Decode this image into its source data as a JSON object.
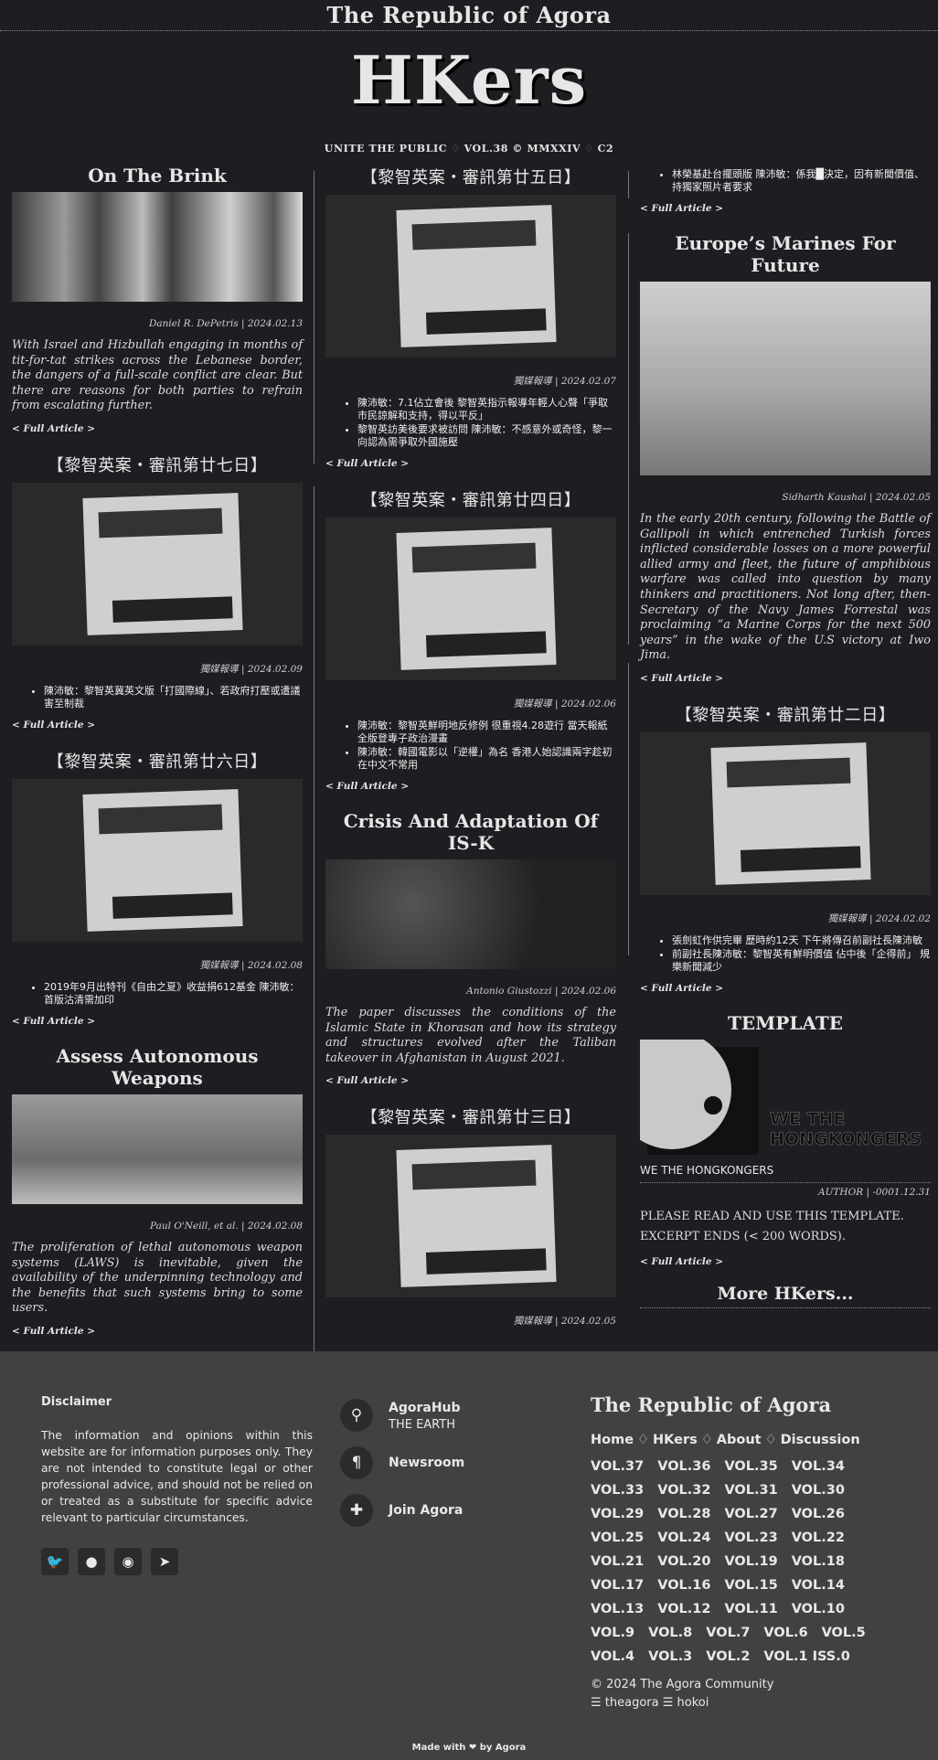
{
  "site": {
    "name": "The Republic of Agora",
    "logo": "HKers",
    "strap_left": "UNITE THE PUBLIC",
    "strap_mid": "VOL.38 © MMXXIV",
    "strap_right": "C2",
    "diamond": "♢",
    "more": "More HKers..."
  },
  "col1": [
    {
      "title": "On The Brink",
      "byline": "Daniel R. DePetris | 2024.02.13",
      "abstract": "With Israel and Hizbullah engaging in months of tit-for-tat strikes across the Lebanese border, the dangers of a full-scale conflict are clear. But there are reasons for both parties to refrain from escalating further.",
      "full": "< Full Article >"
    },
    {
      "title": "【黎智英案・審訊第廿七日】",
      "byline": "獨媒報導 | 2024.02.09",
      "bullets": [
        "陳沛敏：黎智英冀英文版「打國際線」、若政府打壓或遭議害至制裁"
      ],
      "full": "< Full Article >"
    },
    {
      "title": "【黎智英案・審訊第廿六日】",
      "byline": "獨媒報導 | 2024.02.08",
      "bullets": [
        "2019年9月出特刊《自由之夏》收益捐612基金 陳沛敏：首版沽清需加印"
      ],
      "full": "< Full Article >"
    },
    {
      "title": "Assess Autonomous Weapons",
      "byline": "Paul O'Neill, et al. | 2024.02.08",
      "abstract": "The proliferation of lethal autonomous weapon systems (LAWS) is inevitable, given the availability of the underpinning technology and the benefits that such systems bring to some users.",
      "full": "< Full Article >"
    }
  ],
  "col2": [
    {
      "title": "【黎智英案・審訊第廿五日】",
      "byline": "獨媒報導 | 2024.02.07",
      "bullets": [
        "陳沛敏：7.1佔立會後 黎智英指示報導年輕人心聲「爭取市民諒解和支持，得以平反」",
        "黎智英訪美後要求被訪問 陳沛敏：不感意外或奇怪，黎一向認為需爭取外國施壓"
      ],
      "full": "< Full Article >"
    },
    {
      "title": "【黎智英案・審訊第廿四日】",
      "byline": "獨媒報導 | 2024.02.06",
      "bullets": [
        "陳沛敏：黎智英鮮明地反修例 很重視4.28遊行 當天報紙全版登專子政治漫畫",
        "陳沛敏：韓國電影以「逆權」為名 香港人始認識兩字趁初在中文不常用"
      ],
      "full": "< Full Article >"
    },
    {
      "title": "Crisis And Adaptation Of IS-K",
      "byline": "Antonio Giustozzi | 2024.02.06",
      "abstract": "The paper discusses the conditions of the Islamic State in Khorasan and how its strategy and structures evolved after the Taliban takeover in Afghanistan in August 2021.",
      "full": "< Full Article >"
    },
    {
      "title": "【黎智英案・審訊第廿三日】",
      "byline": "獨媒報導 | 2024.02.05"
    }
  ],
  "col3": [
    {
      "bullets": [
        "林榮基赴台擺頭版 陳沛敏：係我█決定，因有新聞價值、持獨家照片者要求"
      ],
      "full": "< Full Article >"
    },
    {
      "title": "Europe’s Marines For Future",
      "byline": "Sidharth Kaushal | 2024.02.05",
      "abstract": "In the early 20th century, following the Battle of Gallipoli in which entrenched Turkish forces inflicted considerable losses on a more powerful allied army and fleet, the future of amphibious warfare was called into question by many thinkers and practitioners. Not long after, then-Secretary of the Navy James Forrestal was proclaiming “a Marine Corps for the next 500 years” in the wake of the U.S victory at Iwo Jima.",
      "full": "< Full Article >"
    },
    {
      "title": "【黎智英案・審訊第廿二日】",
      "byline": "獨媒報導 | 2024.02.02",
      "bullets": [
        "張劍虹作供完畢 歷時約12天 下午將傳召前副社長陳沛敏",
        "前副社長陳沛敏：黎智英有鮮明價值 佔中後「企得前」 規樂新聞減少"
      ],
      "full": "< Full Article >"
    },
    {
      "title": "TEMPLATE",
      "caption": "WE THE HONGKONGERS",
      "logo_text1": "WE THE",
      "logo_text2": "HONGKONGERS",
      "byline": "AUTHOR | -0001.12.31",
      "body": "PLEASE READ AND USE THIS TEMPLATE. EXCERPT ENDS (< 200 WORDS).",
      "full": "< Full Article >"
    }
  ],
  "footer": {
    "disc_title": "Disclaimer",
    "disc_text": "The information and opinions within this website are for information purposes only. They are not intended to constitute legal or other professional advice, and should not be relied on or treated as a substitute for specific advice relevant to particular circumstances.",
    "links": [
      {
        "label": "AgoraHub",
        "sub": "THE EARTH",
        "icon": "location-pin-icon"
      },
      {
        "label": "Newsroom",
        "icon": "pilcrow-icon"
      },
      {
        "label": "Join Agora",
        "icon": "puzzle-icon"
      }
    ],
    "brand": "The Republic of Agora",
    "nav": [
      "Home",
      "HKers",
      "About",
      "Discussion"
    ],
    "vols": [
      "VOL.37",
      "VOL.36",
      "VOL.35",
      "VOL.34",
      "VOL.33",
      "VOL.32",
      "VOL.31",
      "VOL.30",
      "VOL.29",
      "VOL.28",
      "VOL.27",
      "VOL.26",
      "VOL.25",
      "VOL.24",
      "VOL.23",
      "VOL.22",
      "VOL.21",
      "VOL.20",
      "VOL.19",
      "VOL.18",
      "VOL.17",
      "VOL.16",
      "VOL.15",
      "VOL.14",
      "VOL.13",
      "VOL.12",
      "VOL.11",
      "VOL.10",
      "VOL.9",
      "VOL.8",
      "VOL.7",
      "VOL.6",
      "VOL.5",
      "VOL.4",
      "VOL.3",
      "VOL.2",
      "VOL.1 ISS.0"
    ],
    "copyright": "© 2024 The Agora Community",
    "handles": "☰ theagora ☰ hokoi",
    "made": "Made with ❤ by Agora"
  }
}
